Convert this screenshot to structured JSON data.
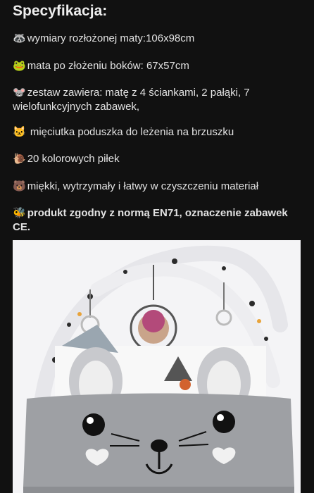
{
  "heading": "Specyfikacja:",
  "specs": [
    {
      "icon": "raccoon-icon",
      "glyph": "🦝",
      "text": "wymiary rozłożonej maty:106x98cm"
    },
    {
      "icon": "frog-icon",
      "glyph": "🐸",
      "text": "mata po złożeniu boków: 67x57cm"
    },
    {
      "icon": "mouse-icon",
      "glyph": "🐭",
      "text": "zestaw zawiera: matę z 4 ściankami, 2 pałąki, 7 wielofunkcyjnych zabawek,"
    },
    {
      "icon": "cat-icon",
      "glyph": "🐱",
      "text": " mięciutka poduszka do leżenia na brzuszku"
    },
    {
      "icon": "snail-icon",
      "glyph": "🐌",
      "text": "20 kolorowych piłek"
    },
    {
      "icon": "bear-icon",
      "glyph": "🐻",
      "text": "miękki, wytrzymały i łatwy w czyszczeniu materiał"
    },
    {
      "icon": "bee-icon",
      "glyph": "🐝",
      "text": "produkt zgodny z normą EN71, oznaczenie zabawek CE."
    }
  ],
  "colors": {
    "background": "#111111",
    "text": "#e2e2e2",
    "photo_bg": "#f4f4f6",
    "mat_grey": "#9ea0a4"
  }
}
